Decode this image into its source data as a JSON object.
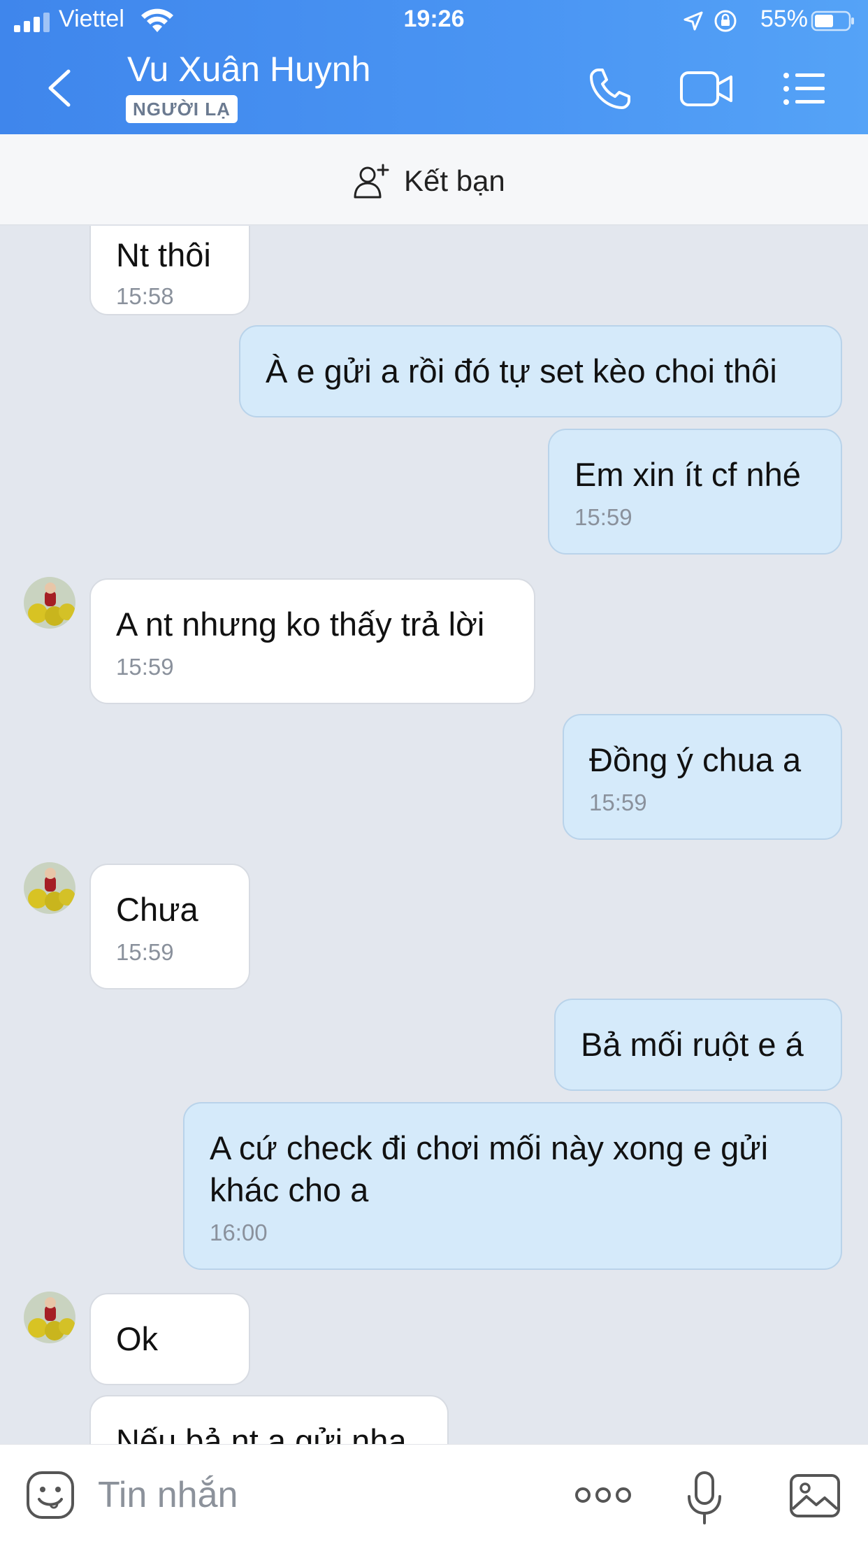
{
  "status_bar": {
    "carrier": "Viettel",
    "time": "19:26",
    "battery": "55%"
  },
  "header": {
    "contact_name": "Vu Xuân Huynh",
    "badge": "NGƯỜI LẠ"
  },
  "add_friend": {
    "label": "Kết bạn"
  },
  "messages": [
    {
      "dir": "in",
      "text": "Nt thôi",
      "time": "15:58"
    },
    {
      "dir": "out",
      "text": "À e gửi a rồi đó tự set kèo choi thôi",
      "time": ""
    },
    {
      "dir": "out",
      "text": "Em xin ít cf nhé",
      "time": "15:59"
    },
    {
      "dir": "in",
      "text": "A nt nhưng ko thấy trả lời",
      "time": "15:59"
    },
    {
      "dir": "out",
      "text": "Đồng ý chua a",
      "time": "15:59"
    },
    {
      "dir": "in",
      "text": "Chưa",
      "time": "15:59"
    },
    {
      "dir": "out",
      "text": "Bả mối ruột e á",
      "time": ""
    },
    {
      "dir": "out",
      "text": "A cứ check đi chơi mối này xong e gửi",
      "text2": "khác cho a",
      "time": "16:00"
    },
    {
      "dir": "in",
      "text": "Ok",
      "time": ""
    },
    {
      "dir": "in",
      "text": "Nếu bả nt a gửi nha",
      "time": ""
    }
  ],
  "input": {
    "placeholder": "Tin nhắn"
  },
  "colors": {
    "header_blue": "#4a95f3",
    "outgoing_bubble": "#d5eafa",
    "incoming_bubble": "#ffffff",
    "chat_bg": "#e3e7ee"
  }
}
